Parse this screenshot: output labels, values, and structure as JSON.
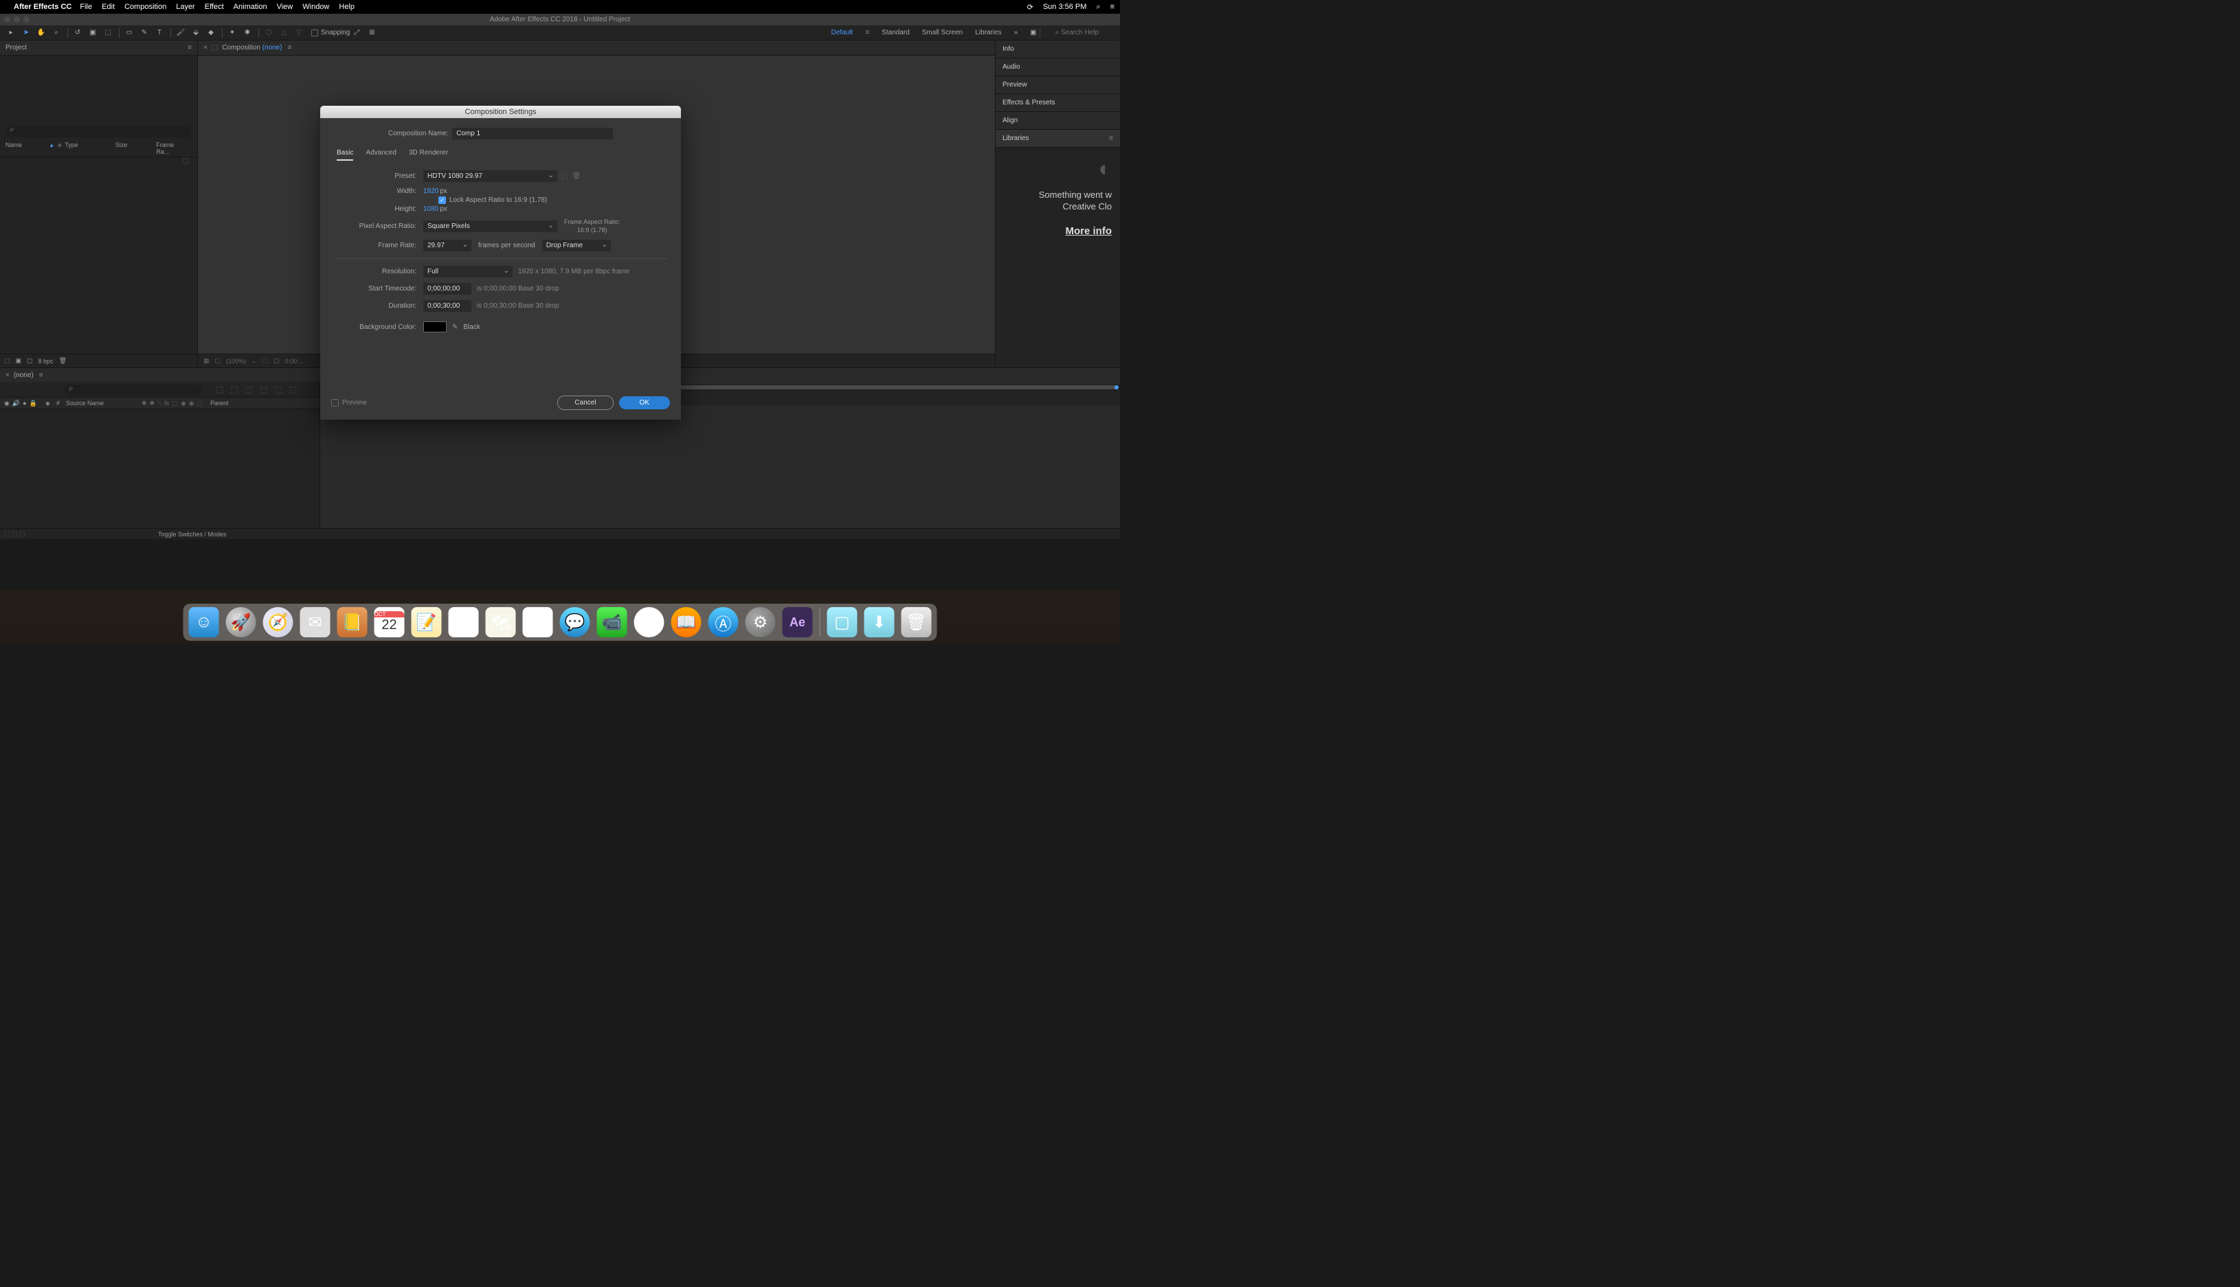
{
  "menubar": {
    "app_name": "After Effects CC",
    "items": [
      "File",
      "Edit",
      "Composition",
      "Layer",
      "Effect",
      "Animation",
      "View",
      "Window",
      "Help"
    ],
    "clock": "Sun 3:56 PM"
  },
  "titlebar": "Adobe After Effects CC 2018 - Untitled Project",
  "toolbar": {
    "snapping_label": "Snapping",
    "workspaces": [
      "Default",
      "Standard",
      "Small Screen",
      "Libraries"
    ],
    "active_workspace": "Default",
    "search_placeholder": "Search Help"
  },
  "project_panel": {
    "tab": "Project",
    "headers": [
      "Name",
      "Type",
      "Size",
      "Frame Ra..."
    ],
    "footer_bpc": "8 bpc"
  },
  "comp_panel": {
    "tab_prefix": "Composition",
    "tab_none": "(none)",
    "footer_zoom": "(100%)",
    "footer_time": "0:00:..."
  },
  "right_panels": {
    "items": [
      "Info",
      "Audio",
      "Preview",
      "Effects & Presets",
      "Align",
      "Libraries"
    ],
    "error_line1": "Something went w",
    "error_line2": "Creative Clo",
    "more_info": "More info"
  },
  "timeline": {
    "tab_none": "(none)",
    "headers": {
      "num": "#",
      "source": "Source Name",
      "parent": "Parent"
    },
    "toggle_label": "Toggle Switches / Modes"
  },
  "dialog": {
    "title": "Composition Settings",
    "name_label": "Composition Name:",
    "name_value": "Comp 1",
    "tabs": [
      "Basic",
      "Advanced",
      "3D Renderer"
    ],
    "preset_label": "Preset:",
    "preset_value": "HDTV 1080 29.97",
    "width_label": "Width:",
    "width_value": "1920",
    "height_label": "Height:",
    "height_value": "1080",
    "px": "px",
    "lock_label": "Lock Aspect Ratio to 16:9 (1.78)",
    "par_label": "Pixel Aspect Ratio:",
    "par_value": "Square Pixels",
    "far_label": "Frame Aspect Ratio:",
    "far_value": "16:9 (1.78)",
    "fr_label": "Frame Rate:",
    "fr_value": "29.97",
    "fps_label": "frames per second",
    "drop_value": "Drop Frame",
    "res_label": "Resolution:",
    "res_value": "Full",
    "res_hint": "1920 x 1080, 7.9 MB per 8bpc frame",
    "tc_label": "Start Timecode:",
    "tc_value": "0;00;00;00",
    "tc_hint": "is 0;00;00;00  Base 30  drop",
    "dur_label": "Duration:",
    "dur_value": "0;00;30;00",
    "dur_hint": "is 0;00;30;00  Base 30  drop",
    "bg_label": "Background Color:",
    "bg_name": "Black",
    "preview_label": "Preview",
    "cancel": "Cancel",
    "ok": "OK"
  },
  "dock": {
    "cal_month": "OCT",
    "cal_day": "22",
    "ae": "Ae"
  }
}
